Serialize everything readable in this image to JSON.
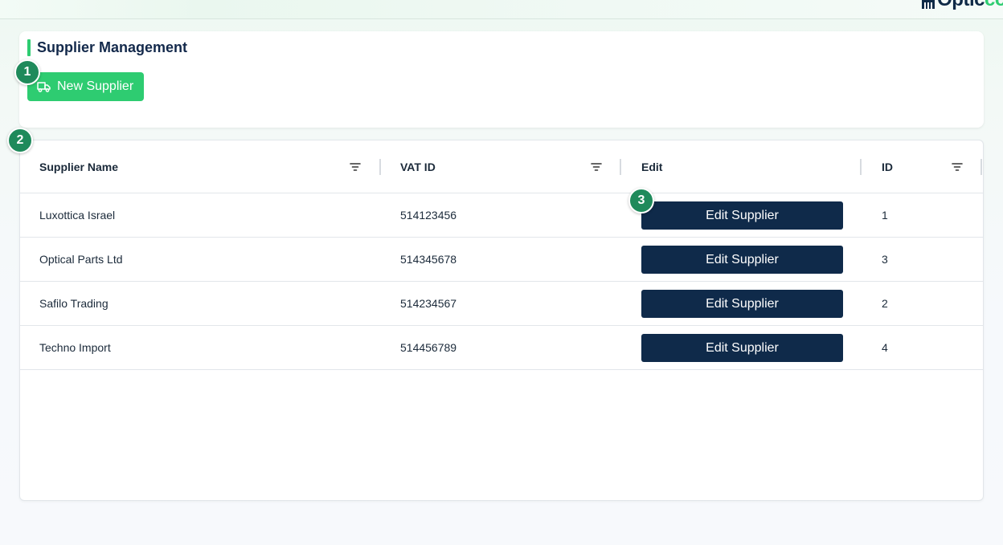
{
  "brand": {
    "logo_text_main": "Optic",
    "logo_text_accent": "co"
  },
  "page": {
    "title": "Supplier Management",
    "new_button_label": "New Supplier"
  },
  "annotations": [
    "1",
    "2",
    "3"
  ],
  "table": {
    "columns": [
      {
        "label": "Supplier Name",
        "filterable": true
      },
      {
        "label": "VAT ID",
        "filterable": true
      },
      {
        "label": "Edit",
        "filterable": false
      },
      {
        "label": "ID",
        "filterable": true
      }
    ],
    "edit_button_label": "Edit Supplier",
    "rows": [
      {
        "name": "Luxottica Israel",
        "vat": "514123456",
        "id": "1"
      },
      {
        "name": "Optical Parts Ltd",
        "vat": "514345678",
        "id": "3"
      },
      {
        "name": "Safilo Trading",
        "vat": "514234567",
        "id": "2"
      },
      {
        "name": "Techno Import",
        "vat": "514456789",
        "id": "4"
      }
    ]
  },
  "colors": {
    "accent": "#2ecc71",
    "navy": "#0f2a4a",
    "badge": "#1f8a5b"
  }
}
